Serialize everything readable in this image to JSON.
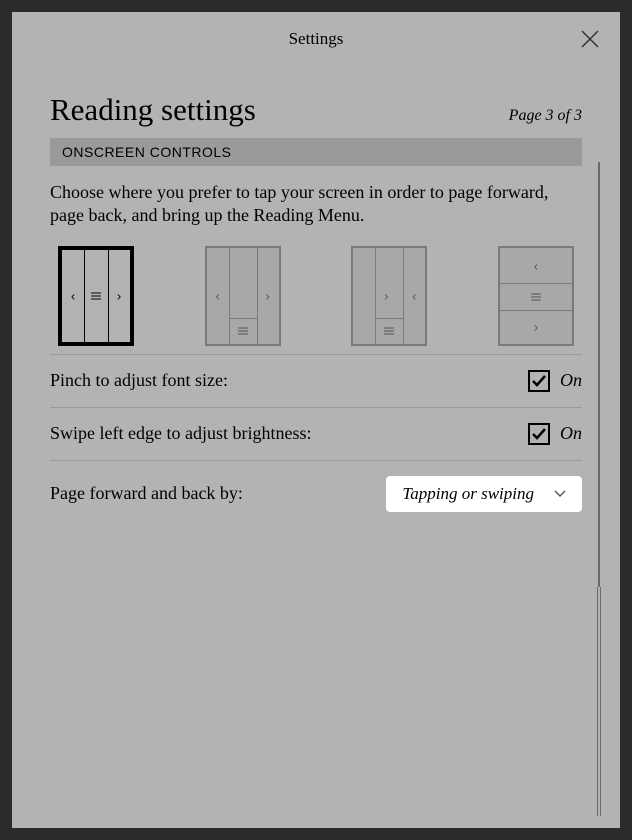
{
  "dialog": {
    "title": "Settings"
  },
  "page": {
    "title": "Reading settings",
    "indicator": "Page 3 of 3"
  },
  "section": {
    "header": "ONSCREEN CONTROLS",
    "description": "Choose where you prefer to tap your screen in order to page forward, page back, and bring up the Reading Menu."
  },
  "settings": {
    "pinch": {
      "label": "Pinch to adjust font size:",
      "state": "On"
    },
    "swipe": {
      "label": "Swipe left edge to adjust brightness:",
      "state": "On"
    },
    "paging": {
      "label": "Page forward and back by:",
      "value": "Tapping or swiping"
    }
  }
}
